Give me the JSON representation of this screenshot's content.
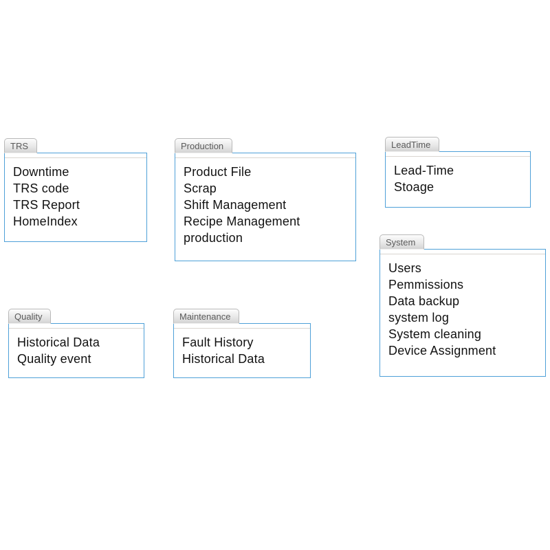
{
  "panels": {
    "trs": {
      "tab": "TRS",
      "items": [
        "Downtime",
        "TRS code",
        "TRS Report",
        "HomeIndex"
      ]
    },
    "production": {
      "tab": "Production",
      "items": [
        "Product File",
        "Scrap",
        "Shift Management",
        "Recipe Management",
        "production"
      ]
    },
    "leadtime": {
      "tab": "LeadTime",
      "items": [
        "Lead-Time",
        "Stoage"
      ]
    },
    "quality": {
      "tab": "Quality",
      "items": [
        "Historical Data",
        "Quality event"
      ]
    },
    "maintenance": {
      "tab": "Maintenance",
      "items": [
        "Fault History",
        "Historical Data"
      ]
    },
    "system": {
      "tab": "System",
      "items": [
        "Users",
        "Pemmissions",
        "Data backup",
        "system log",
        "System cleaning",
        "Device Assignment"
      ]
    }
  }
}
